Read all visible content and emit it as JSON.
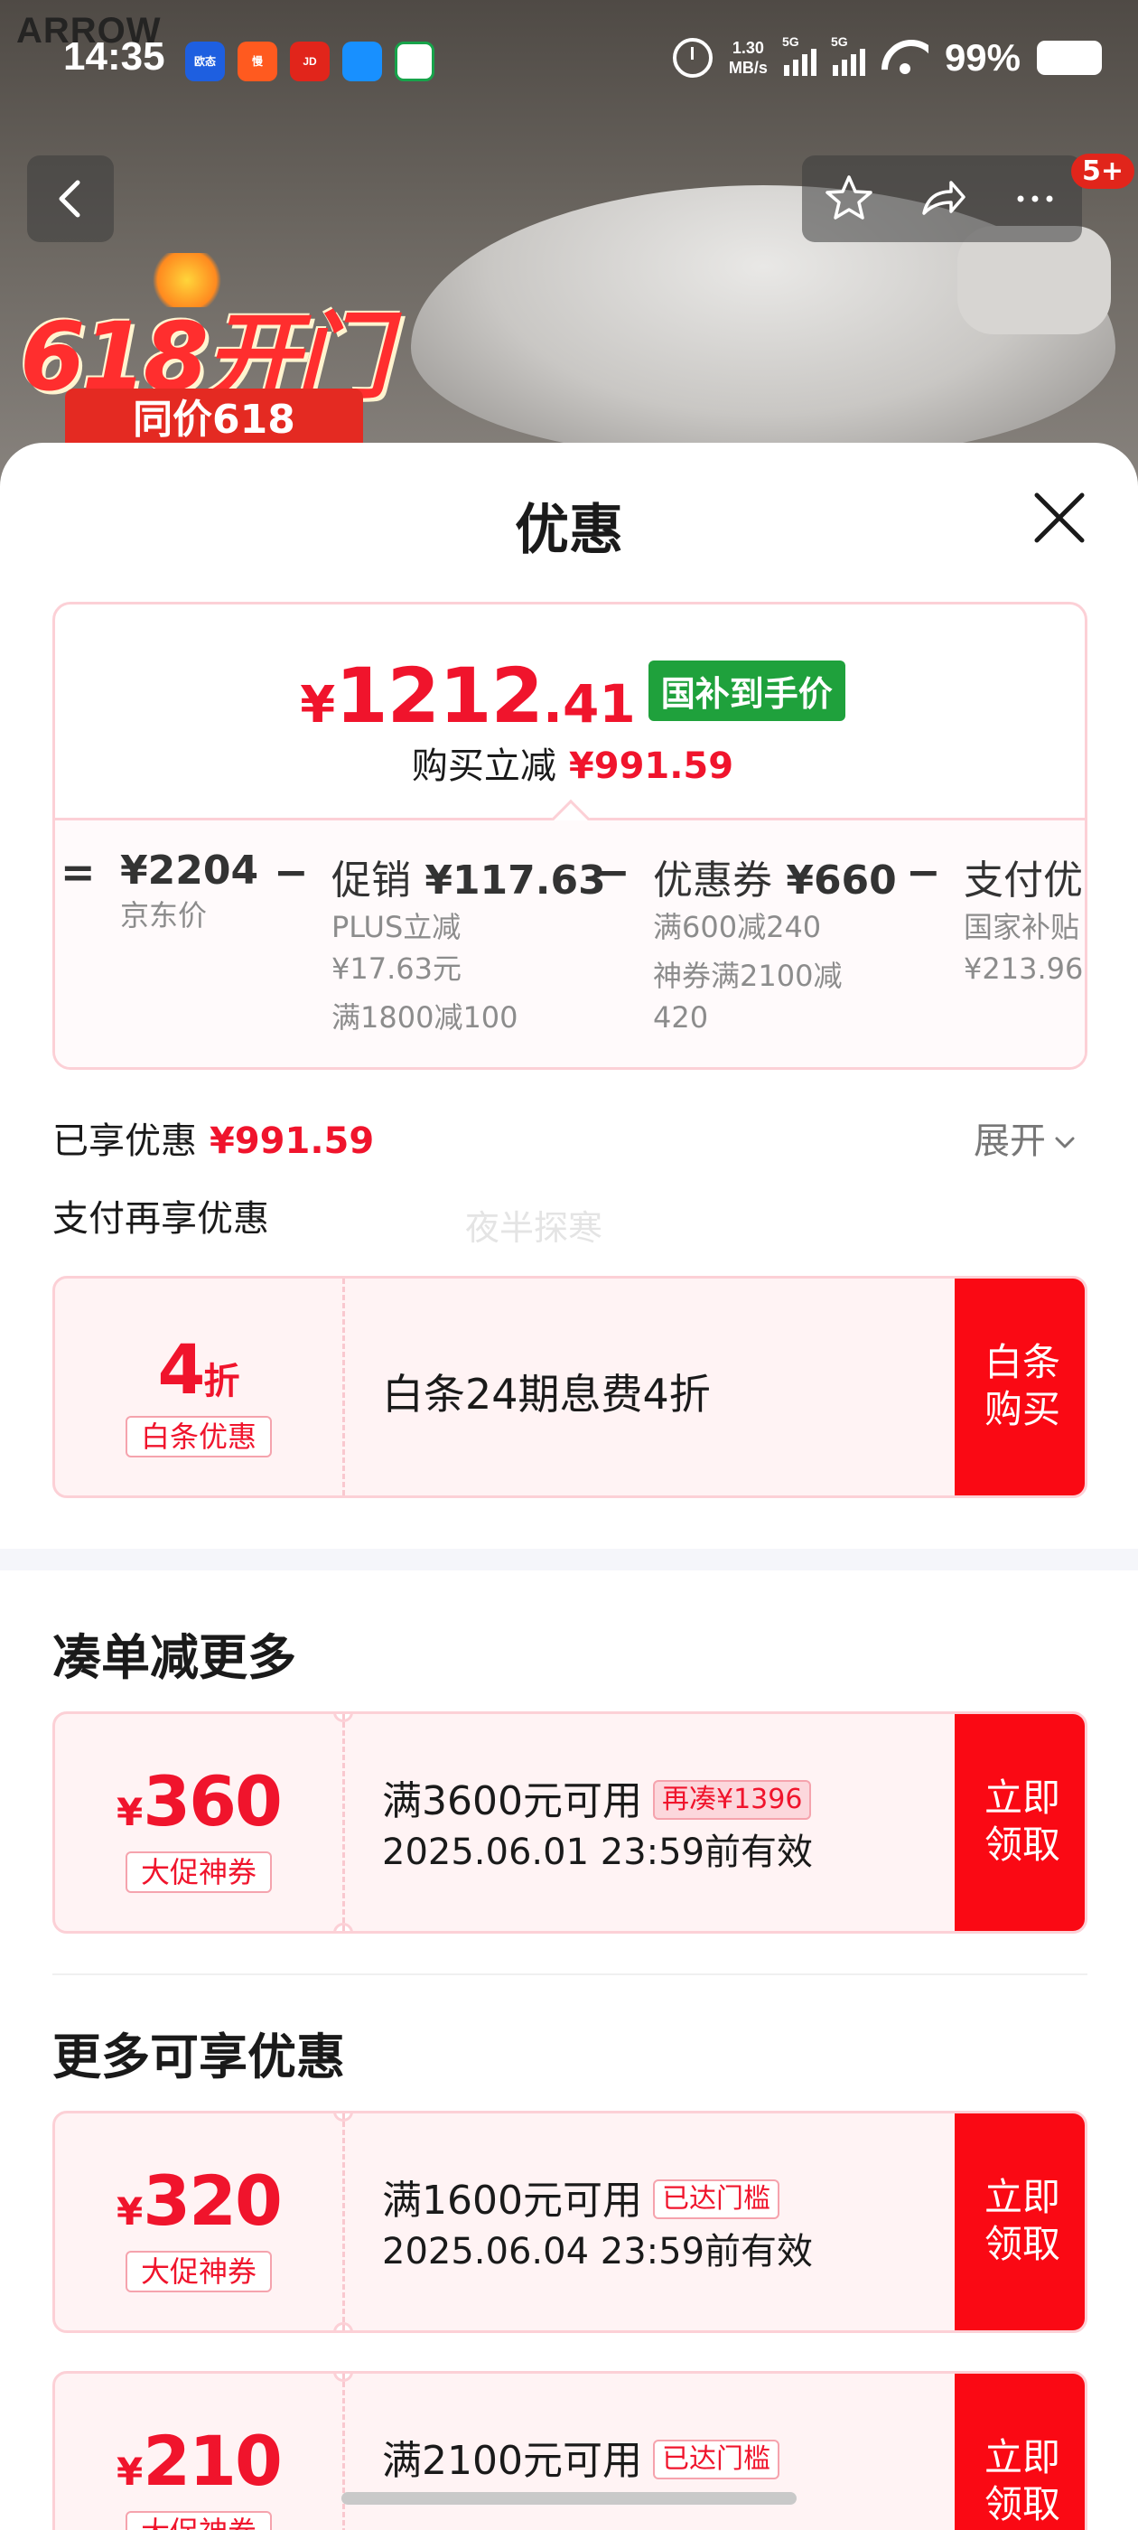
{
  "status_bar": {
    "time": "14:35",
    "net_speed_value": "1.30",
    "net_speed_unit": "MB/s",
    "sim1": "5G",
    "sim2": "5G",
    "battery": "99%",
    "app_icons": [
      "欧态",
      "慢",
      "JD",
      "app",
      "app"
    ]
  },
  "background": {
    "brand": "ARROW",
    "promo_main": "618开门红",
    "promo_sub": "同价618"
  },
  "nav": {
    "badge": "5+",
    "icons": [
      "back-icon",
      "star-icon",
      "share-icon",
      "more-icon"
    ]
  },
  "sheet": {
    "title": "优惠",
    "price": {
      "currency": "¥",
      "integer": "1212",
      "decimal": ".41",
      "tag": "国补到手价",
      "buy_reduce_label": "购买立减",
      "buy_reduce_amount": "¥991.59"
    },
    "breakdown": {
      "equals": "=",
      "minus": "−",
      "items": [
        {
          "head": "¥2204",
          "subs": [
            "京东价"
          ]
        },
        {
          "label": "促销",
          "amount": "¥117.63",
          "subs": [
            "PLUS立减",
            "¥17.63元",
            "满1800减100"
          ]
        },
        {
          "label": "优惠券",
          "amount": "¥660",
          "subs": [
            "满600减240",
            "神券满2100减",
            "420"
          ]
        },
        {
          "label": "支付优惠",
          "subs": [
            "国家补贴",
            "¥213.96"
          ]
        }
      ]
    },
    "enjoyed_label": "已享优惠",
    "enjoyed_amount": "¥991.59",
    "expand": "展开",
    "pay_more": "支付再享优惠",
    "watermark": "夜半探寒",
    "baitiao": {
      "big": "4",
      "unit": "折",
      "tag": "白条优惠",
      "text": "白条24期息费4折",
      "button": "白条购买"
    },
    "section_1": "凑单减更多",
    "section_2": "更多可享优惠",
    "coupons": [
      {
        "currency": "¥",
        "amount": "360",
        "tag": "大促神券",
        "title": "满3600元可用",
        "chip": "再凑¥1396",
        "date": "2025.06.01 23:59前有效",
        "button": "立即领取"
      },
      {
        "currency": "¥",
        "amount": "320",
        "tag": "大促神券",
        "title": "满1600元可用",
        "chip": "已达门槛",
        "date": "2025.06.04 23:59前有效",
        "button": "立即领取"
      },
      {
        "currency": "¥",
        "amount": "210",
        "tag": "大促神券",
        "title": "满2100元可用",
        "chip": "已达门槛",
        "date": "",
        "button": "立即领取"
      }
    ]
  },
  "colors": {
    "accent_red": "#f0142c",
    "button_red": "#fa0914",
    "green_tag": "#1fa13c",
    "pink_border": "#fcd0d6",
    "coupon_bg": "#fff3f4"
  }
}
